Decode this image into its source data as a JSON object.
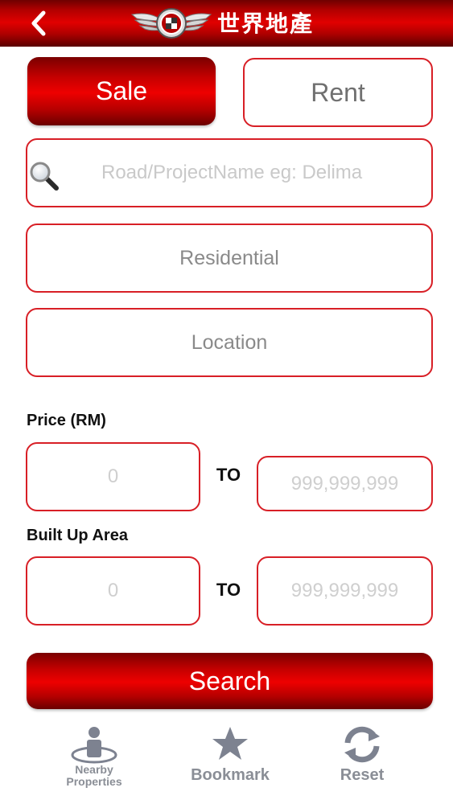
{
  "header": {
    "title": "世界地產"
  },
  "mode_tabs": {
    "sale": "Sale",
    "rent": "Rent",
    "selected": "Sale"
  },
  "search": {
    "placeholder": "Road/ProjectName eg: Delima"
  },
  "property_type": {
    "value": "Residential"
  },
  "location": {
    "value": "Location"
  },
  "price": {
    "label": "Price (RM)",
    "min_placeholder": "0",
    "to": "TO",
    "max_placeholder": "999,999,999"
  },
  "built_up_area": {
    "label": "Built Up Area",
    "min_placeholder": "0",
    "to": "TO",
    "max_placeholder": "999,999,999"
  },
  "search_button": {
    "label": "Search"
  },
  "tabbar": {
    "nearby_line1": "Nearby",
    "nearby_line2": "Properties",
    "bookmark": "Bookmark",
    "reset": "Reset"
  },
  "colors": {
    "brand_red": "#d81f26",
    "header_red": "#c00000",
    "tab_icon_gray": "#7d8290"
  },
  "icons": {
    "back": "chevron-left-icon",
    "logo": "winged-emblem-logo",
    "search": "magnifier-icon",
    "nearby": "person-pin-icon",
    "bookmark": "star-icon",
    "reset": "refresh-icon"
  }
}
